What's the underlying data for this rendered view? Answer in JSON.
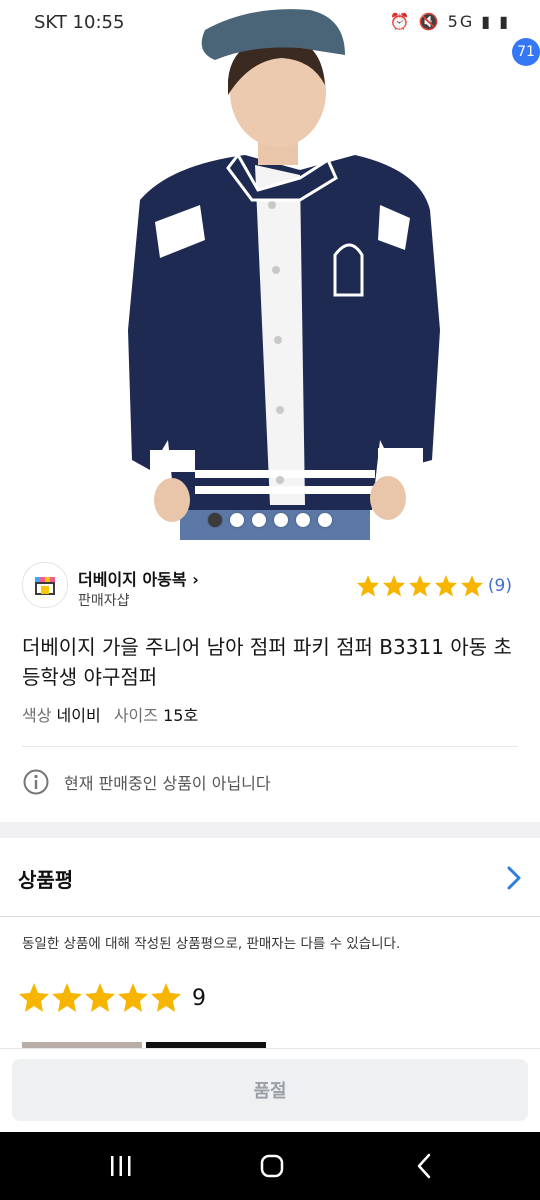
{
  "status_bar": {
    "time": "SKT 10:55",
    "left_icons": "▣ © ⁂",
    "right_icons": "⏰ 🔇 5G ▮ ▮"
  },
  "nav": {
    "cart_count": "71",
    "icons": [
      "back-icon",
      "search-icon",
      "home-icon",
      "cart-icon"
    ]
  },
  "carousel": {
    "total": 6,
    "active_index": 0
  },
  "seller": {
    "name": "더베이지 아동복 ",
    "chevron": "›",
    "type": "판매자샵"
  },
  "rating": {
    "stars": 5,
    "count": "(9)"
  },
  "product": {
    "title": "더베이지 가을 주니어 남아 점퍼 파키 점퍼 B3311 아동 초등학생 야구점퍼",
    "option_color_label": "색상",
    "option_color_value": "네이비",
    "option_size_label": "사이즈",
    "option_size_value": "15호"
  },
  "notice": {
    "text": "현재 판매중인 상품이 아닙니다"
  },
  "reviews": {
    "heading": "상품평",
    "note": "동일한 상품에 대해 작성된 상품평으로, 판매자는 다를 수 있습니다.",
    "score_stars": 5,
    "count": "9"
  },
  "bottom": {
    "button_label": "품절"
  },
  "colors": {
    "star": "#f7b500",
    "accent_blue": "#3478f6",
    "jacket_navy": "#1e2a52"
  }
}
